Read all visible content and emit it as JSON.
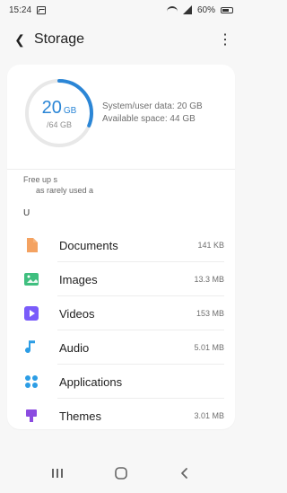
{
  "status_bar": {
    "time": "15:24",
    "battery_percent": "60%"
  },
  "app_bar": {
    "title": "Storage",
    "back_icon": "arrow-left-icon",
    "menu_icon": "more-vertical-icon"
  },
  "storage_summary": {
    "used_value": "20",
    "used_unit": "GB",
    "total": "/64 GB",
    "system_user_data": "System/user data: 20 GB",
    "available_space": "Available space: 44 GB",
    "used_fraction": 0.3125
  },
  "free_up": {
    "line1": "Free up s",
    "line2": "as rarely used a"
  },
  "usage_label": "U",
  "categories": [
    {
      "label": "Documents",
      "size": "141 KB",
      "icon": "document-icon",
      "color": "#F4A261"
    },
    {
      "label": "Images",
      "size": "13.3 MB",
      "icon": "image-icon",
      "color": "#3FBF7F"
    },
    {
      "label": "Videos",
      "size": "153 MB",
      "icon": "video-icon",
      "color": "#7A5CFA"
    },
    {
      "label": "Audio",
      "size": "5.01 MB",
      "icon": "music-note-icon",
      "color": "#2C9DE5"
    },
    {
      "label": "Applications",
      "size": "",
      "icon": "apps-icon",
      "color": "#2C9DE5"
    },
    {
      "label": "Themes",
      "size": "3.01 MB",
      "icon": "brush-icon",
      "color": "#8B4BE0"
    }
  ],
  "nav": {
    "recents_icon": "recents-icon",
    "home_icon": "home-icon",
    "back_icon": "back-icon"
  },
  "colors": {
    "accent": "#2b86d6",
    "ring_track": "#e8e8e8"
  }
}
